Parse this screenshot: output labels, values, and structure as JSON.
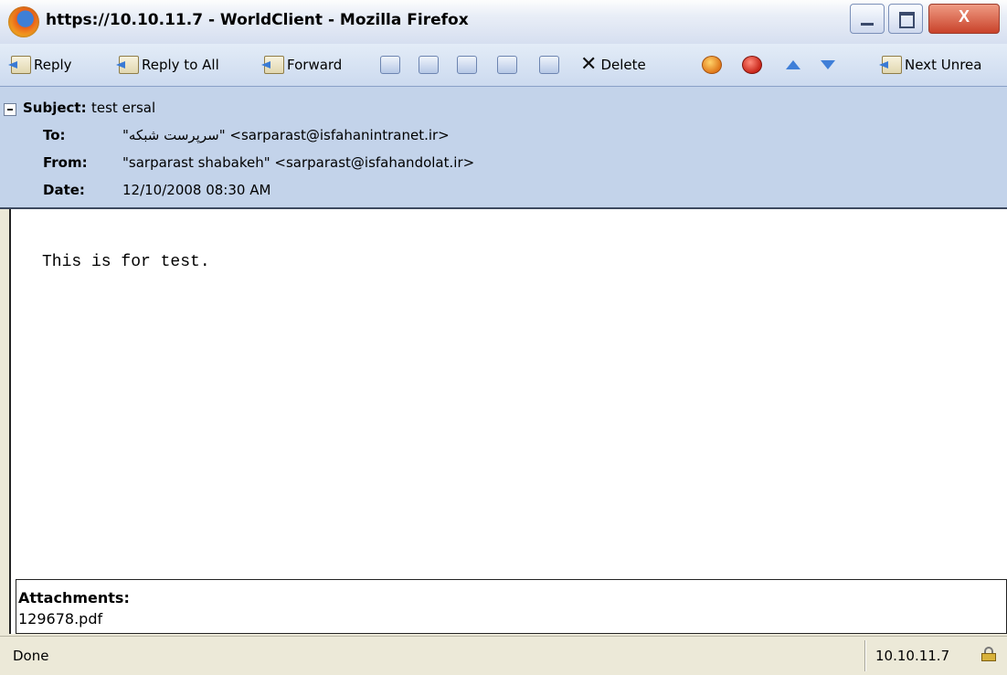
{
  "window": {
    "title": "https://10.10.11.7 - WorldClient - Mozilla Firefox",
    "close_glyph": "X"
  },
  "toolbar": {
    "reply": "Reply",
    "reply_all": "Reply to All",
    "forward": "Forward",
    "delete": "Delete",
    "next_unread": "Next Unrea"
  },
  "header": {
    "subject_label": "Subject:",
    "subject": "test ersal",
    "to_label": "To:",
    "to": "\"سرپرست شبکه\" <sarparast@isfahanintranet.ir>",
    "from_label": "From:",
    "from": "\"sarparast shabakeh\" <sarparast@isfahandolat.ir>",
    "date_label": "Date:",
    "date": "12/10/2008 08:30 AM"
  },
  "message": {
    "body": "This is for test."
  },
  "attachments": {
    "label": "Attachments:",
    "files": [
      "129678.pdf"
    ]
  },
  "status": {
    "text": "Done",
    "host": "10.10.11.7"
  },
  "icons": {
    "firefox": "firefox-logo-icon",
    "reply": "reply-icon",
    "reply_all": "reply-all-icon",
    "forward": "forward-icon",
    "delete": "delete-x-icon",
    "spam": "spam-icon",
    "block": "block-icon",
    "prev": "arrow-up-icon",
    "next": "arrow-down-icon",
    "next_unread": "next-unread-icon",
    "lock": "lock-icon"
  }
}
